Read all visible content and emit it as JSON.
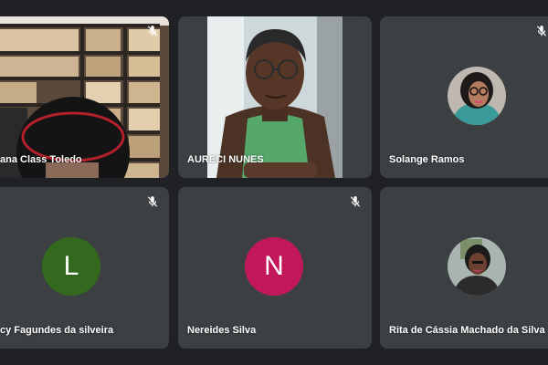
{
  "participants": [
    {
      "name": "ana Class Toledo",
      "muted": true,
      "video": true
    },
    {
      "name": "AURECI NUNES",
      "muted": false,
      "video": true
    },
    {
      "name": "Solange Ramos",
      "muted": true,
      "video": false,
      "avatar": "photo"
    },
    {
      "name": "cy Fagundes da silveira",
      "muted": true,
      "video": false,
      "avatar": "letter",
      "initial": "L",
      "color": "#33691e"
    },
    {
      "name": "Nereides Silva",
      "muted": true,
      "video": false,
      "avatar": "letter",
      "initial": "N",
      "color": "#c2185b"
    },
    {
      "name": "Rita de Cássia Machado da Silva",
      "muted": false,
      "video": false,
      "avatar": "photo"
    }
  ],
  "colors": {
    "background": "#202124",
    "tile": "#3c4043"
  },
  "icons": {
    "mute": "mic-off-icon"
  }
}
